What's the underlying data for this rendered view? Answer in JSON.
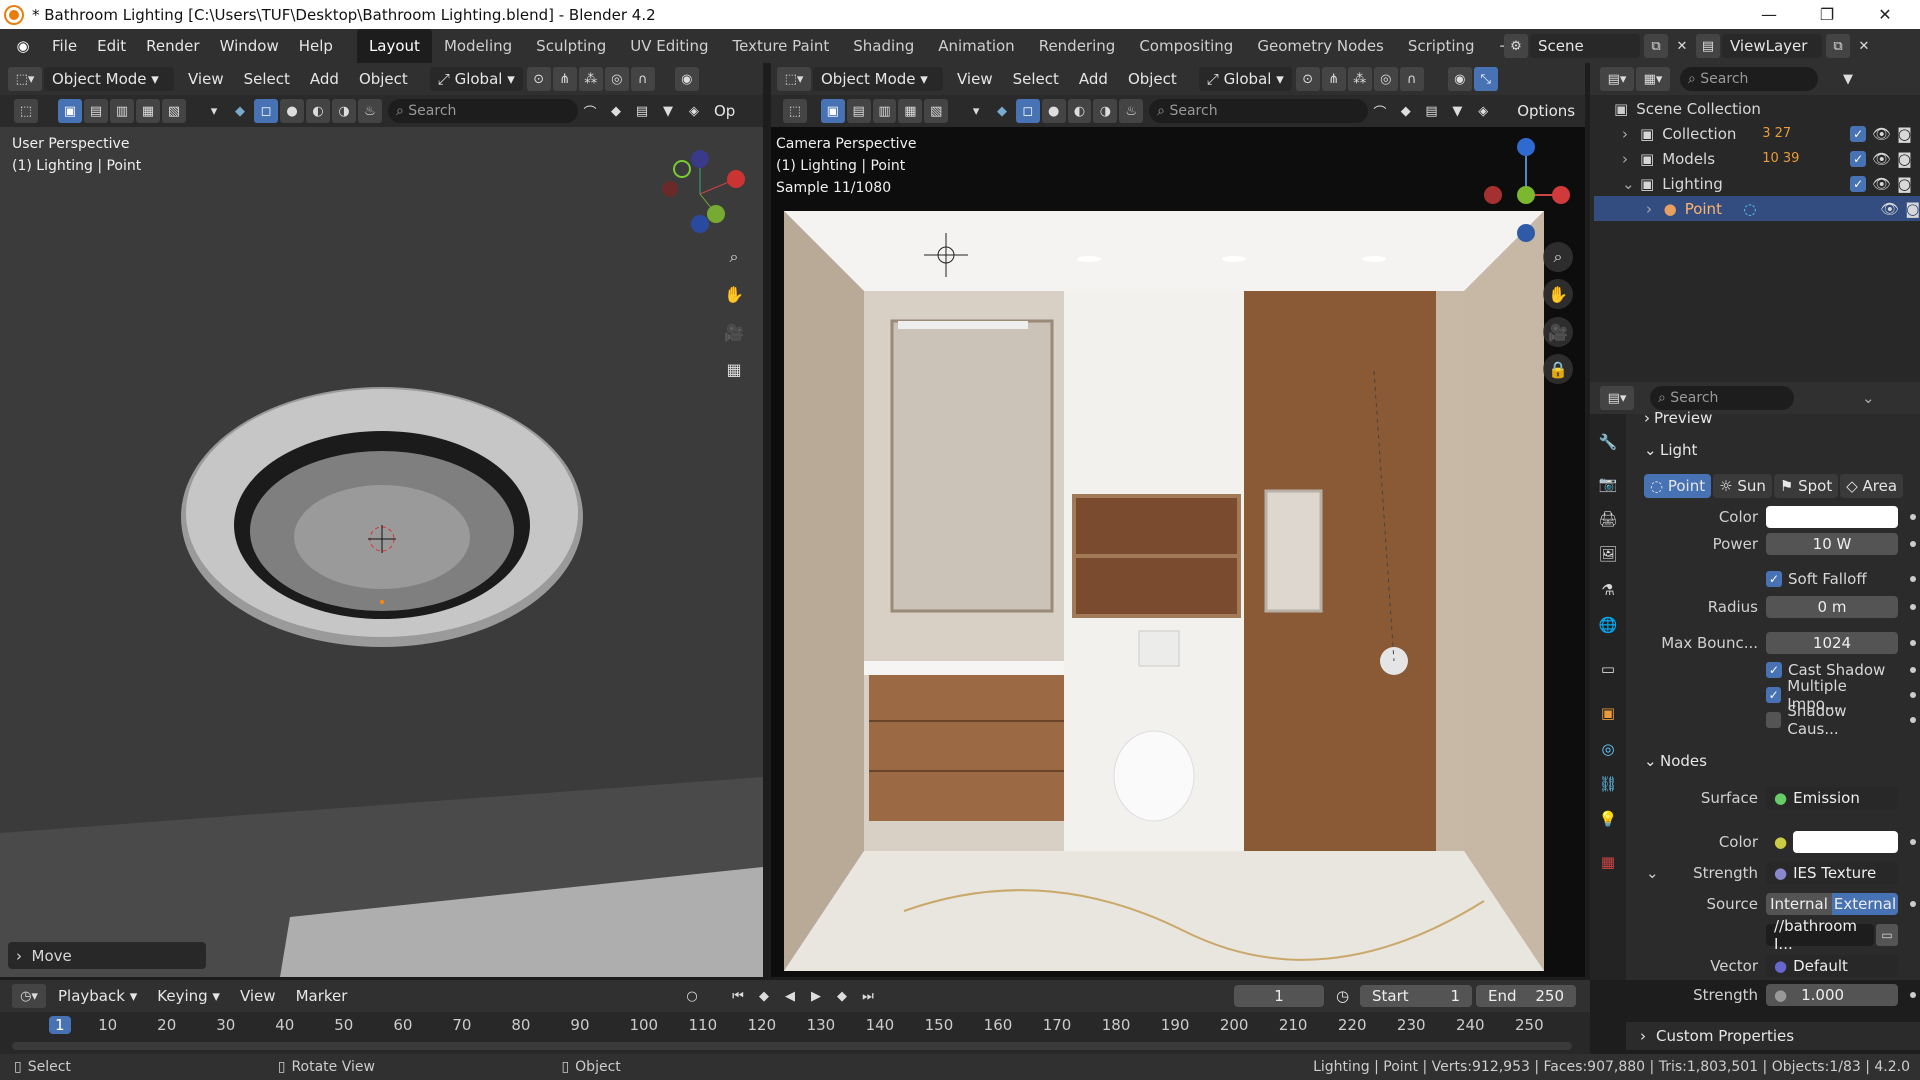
{
  "window": {
    "title": "* Bathroom Lighting [C:\\Users\\TUF\\Desktop\\Bathroom Lighting.blend] - Blender 4.2"
  },
  "menus": [
    "File",
    "Edit",
    "Render",
    "Window",
    "Help"
  ],
  "workspaces": [
    "Layout",
    "Modeling",
    "Sculpting",
    "UV Editing",
    "Texture Paint",
    "Shading",
    "Animation",
    "Rendering",
    "Compositing",
    "Geometry Nodes",
    "Scripting"
  ],
  "scene": {
    "scene_name": "Scene",
    "view_layer": "ViewLayer"
  },
  "vp1": {
    "mode": "Object Mode",
    "menus": [
      "View",
      "Select",
      "Add",
      "Object"
    ],
    "orientation": "Global",
    "search_placeholder": "Search",
    "options_short": "Op",
    "view_label": "User Perspective",
    "sel_label": "(1) Lighting | Point",
    "last_op": "Move"
  },
  "vp2": {
    "mode": "Object Mode",
    "menus": [
      "View",
      "Select",
      "Add",
      "Object"
    ],
    "orientation": "Global",
    "search_placeholder": "Search",
    "options": "Options",
    "view_label": "Camera Perspective",
    "sel_label": "(1) Lighting | Point",
    "sample": "Sample 11/1080"
  },
  "outliner": {
    "search_placeholder": "Search",
    "root": "Scene Collection",
    "items": [
      {
        "label": "Collection",
        "counts": "3 27"
      },
      {
        "label": "Models",
        "counts": "10 39"
      },
      {
        "label": "Lighting"
      },
      {
        "label": "Point"
      }
    ]
  },
  "props": {
    "search_placeholder": "Search",
    "preview": "Preview",
    "light_section": "Light",
    "light_types": [
      "Point",
      "Sun",
      "Spot",
      "Area"
    ],
    "color_label": "Color",
    "color_value": "#ffffff",
    "power_label": "Power",
    "power": "10 W",
    "soft_falloff": "Soft Falloff",
    "radius_label": "Radius",
    "radius": "0 m",
    "max_bounce_label": "Max Bounc...",
    "max_bounce": "1024",
    "cast_shadow": "Cast Shadow",
    "multiple_imp": "Multiple Impo...",
    "shadow_caus": "Shadow Caus...",
    "nodes_section": "Nodes",
    "surface_label": "Surface",
    "surface": "Emission",
    "ncolor_label": "Color",
    "strength_label": "Strength",
    "strength_node": "IES Texture",
    "source_label": "Source",
    "source_internal": "Internal",
    "source_external": "External",
    "filepath": "//bathroom I...",
    "vector_label": "Vector",
    "vector": "Default",
    "strength2_label": "Strength",
    "strength2": "1.000",
    "custom_props": "Custom Properties"
  },
  "timeline": {
    "menus": [
      "Playback",
      "Keying",
      "View",
      "Marker"
    ],
    "current_frame": "1",
    "start_label": "Start",
    "start": "1",
    "end_label": "End",
    "end": "250",
    "ticks": [
      "1",
      "10",
      "20",
      "30",
      "40",
      "50",
      "60",
      "70",
      "80",
      "90",
      "100",
      "110",
      "120",
      "130",
      "140",
      "150",
      "160",
      "170",
      "180",
      "190",
      "200",
      "210",
      "220",
      "230",
      "240",
      "250"
    ]
  },
  "status": {
    "select": "Select",
    "rotate": "Rotate View",
    "object": "Object",
    "info": "Lighting | Point | Verts:912,953 | Faces:907,880 | Tris:1,803,501 | Objects:1/83 | 4.2.0"
  },
  "colors": {
    "accent": "#4772b3",
    "header": "#303030",
    "panel": "#2b2b2b",
    "viewport_bg": "#3d3d3d"
  },
  "icons": [
    "blender-logo-icon",
    "editor-type-icon",
    "object-mode-icon",
    "snap-icon",
    "proportional-icon",
    "overlay-icon",
    "shading-icon",
    "filter-icon",
    "eye-icon",
    "camera-icon",
    "zoom-icon",
    "hand-icon",
    "grid-icon",
    "play-icon"
  ]
}
